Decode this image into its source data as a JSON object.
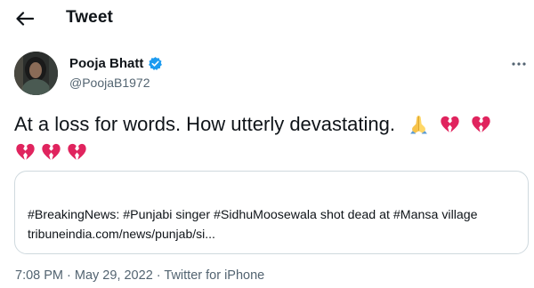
{
  "header": {
    "back_icon": "arrow-left-icon",
    "title": "Tweet"
  },
  "author": {
    "name": "Pooja Bhatt",
    "handle": "@PoojaB1972",
    "verified_icon": "verified-badge-icon",
    "verified_color": "#1d9bf0"
  },
  "more_icon": "more-horizontal-icon",
  "tweet": {
    "text": "At a loss for words. How utterly devastating.",
    "emojis_line1": [
      "folded-hands-icon",
      "broken-heart-icon",
      "broken-heart-icon"
    ],
    "emojis_line2": [
      "broken-heart-icon",
      "broken-heart-icon",
      "broken-heart-icon"
    ]
  },
  "card": {
    "headline": "#BreakingNews: #Punjabi singer #SidhuMoosewala shot dead at #Mansa village",
    "url": "tribuneindia.com/news/punjab/si..."
  },
  "meta": {
    "time": "7:08 PM",
    "separator": " · ",
    "date": "May 29, 2022",
    "source": "Twitter for iPhone"
  },
  "colors": {
    "text": "#0f1419",
    "secondary": "#536471",
    "border": "#cfd9de",
    "heart": "#e0245e"
  }
}
